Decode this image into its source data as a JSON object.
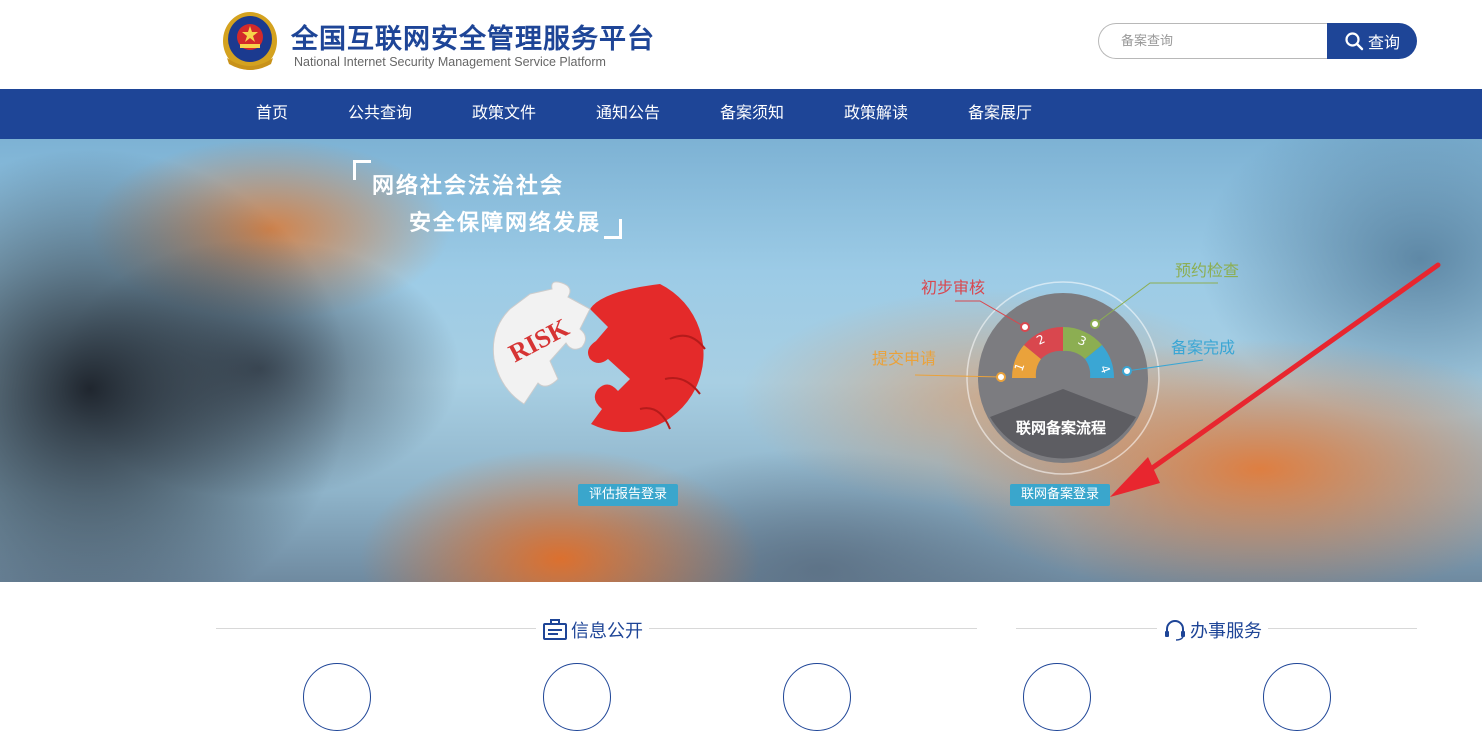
{
  "header": {
    "title": "全国互联网安全管理服务平台",
    "subtitle": "National Internet Security Management Service Platform",
    "search_placeholder": "备案查询",
    "search_button": "查询"
  },
  "nav": {
    "items": [
      "首页",
      "公共查询",
      "政策文件",
      "通知公告",
      "备案须知",
      "政策解读",
      "备案展厅"
    ]
  },
  "banner": {
    "slogan_line1": "网络社会法治社会",
    "slogan_line2": "安全保障网络发展",
    "puzzle_text": "RISK",
    "eval_login_button": "评估报告登录",
    "flow": {
      "center_label": "联网备案流程",
      "steps": [
        {
          "num": "1",
          "label": "提交申请",
          "color": "#eaa23b"
        },
        {
          "num": "2",
          "label": "初步审核",
          "color": "#d9474e"
        },
        {
          "num": "3",
          "label": "预约检查",
          "color": "#8cae52"
        },
        {
          "num": "4",
          "label": "备案完成",
          "color": "#3aa6d4"
        }
      ]
    },
    "filing_login_button": "联网备案登录"
  },
  "sections": {
    "info_title": "信息公开",
    "service_title": "办事服务"
  },
  "colors": {
    "brand": "#1e4597",
    "button_accent": "#3aa6cc",
    "arrow": "#e8262f"
  }
}
